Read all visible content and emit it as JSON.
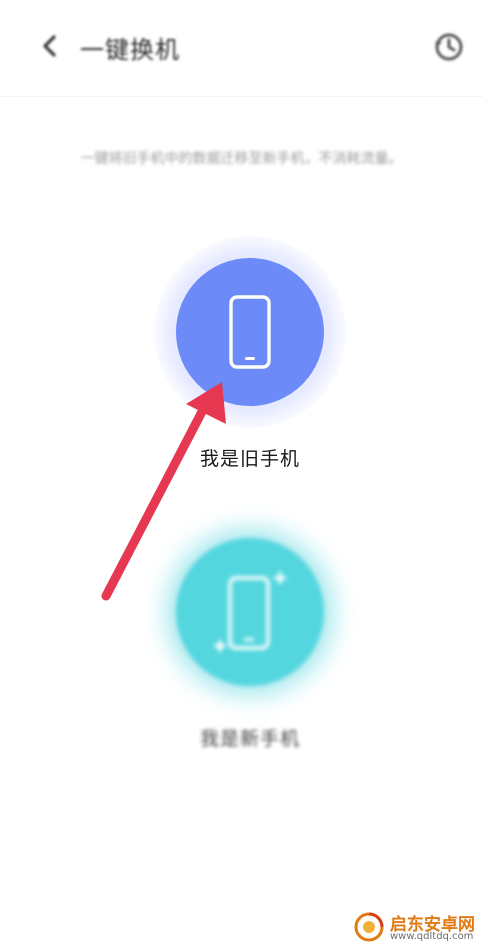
{
  "header": {
    "title": "一键换机"
  },
  "description": "一键将旧手机中的数据迁移至新手机，不消耗流量。",
  "options": {
    "old_phone_label": "我是旧手机",
    "new_phone_label": "我是新手机"
  },
  "colors": {
    "old_phone_circle": "#6c8af8",
    "new_phone_circle": "#54d6de",
    "annotation_arrow": "#e63850",
    "watermark_orange": "#e07a14"
  },
  "icons": {
    "back": "chevron-left-icon",
    "history": "history-icon",
    "old_phone": "phone-icon",
    "new_phone": "phone-sparkle-icon"
  },
  "watermark": {
    "name": "启东安卓网",
    "url": "www.qdltdq.com"
  }
}
